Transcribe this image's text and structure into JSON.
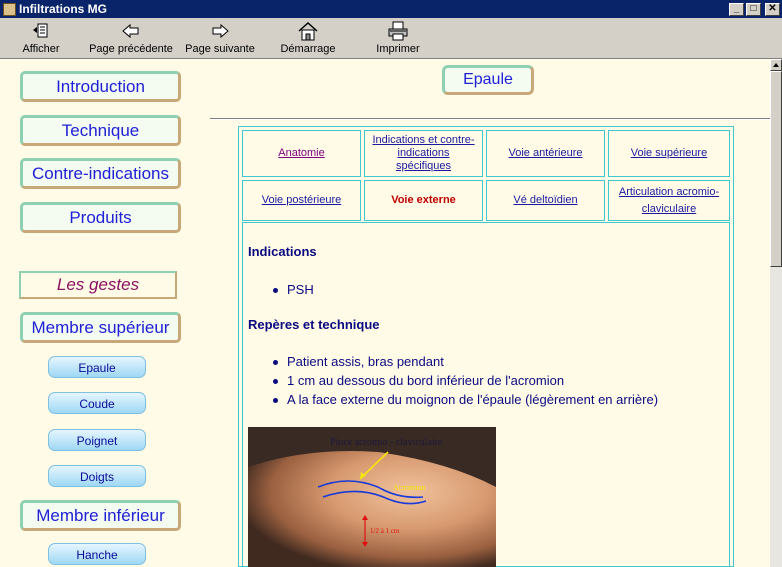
{
  "window": {
    "title": "Infiltrations MG",
    "controls": [
      "_",
      "□",
      "✕"
    ]
  },
  "toolbar": {
    "buttons": [
      {
        "label": "Afficher",
        "icon": "show-icon"
      },
      {
        "label": "Page précédente",
        "icon": "back-arrow-icon"
      },
      {
        "label": "Page suivante",
        "icon": "forward-arrow-icon"
      },
      {
        "label": "Démarrage",
        "icon": "home-icon"
      },
      {
        "label": "Imprimer",
        "icon": "printer-icon"
      }
    ]
  },
  "sidebar": {
    "main": [
      "Introduction",
      "Technique",
      "Contre-indications",
      "Produits"
    ],
    "gestes": "Les gestes",
    "membre_sup": "Membre supérieur",
    "sup_items": [
      "Epaule",
      "Coude",
      "Poignet",
      "Doigts"
    ],
    "membre_inf": "Membre inférieur",
    "inf_items": [
      "Hanche"
    ]
  },
  "page": {
    "title": "Epaule",
    "tabs_row1": [
      "Anatomie",
      "Indications et contre-indications spécifiques",
      "Voie antérieure",
      "Voie supérieure"
    ],
    "tabs_row2": [
      "Voie postérieure",
      "Voie externe",
      "Vé deltoïdien",
      "Articulation acromio-claviculaire"
    ],
    "current_tab": "Voie externe",
    "sections": {
      "indications_title": "Indications",
      "indications": [
        "PSH"
      ],
      "reperes_title": "Repères et technique",
      "reperes": [
        "Patient assis, bras pendant",
        "1 cm au dessous du bord inférieur de l'acromion",
        "A la face externe du moignon de l'épaule (légèrement en arrière)"
      ]
    },
    "photo": {
      "annotation_top": "Pince acromio - claviculaire",
      "annotation_mid": "Acromion",
      "annotation_measure": "1/2 à 1 cm",
      "colors": {
        "skin": "#d0916a",
        "arrow": "#f5e60a",
        "outline": "#1a3ad8",
        "measure": "#e01010"
      }
    }
  }
}
